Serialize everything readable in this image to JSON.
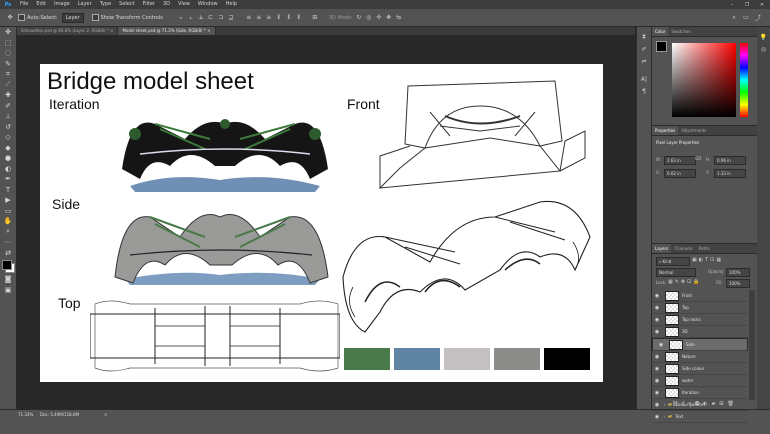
{
  "menubar": {
    "logo": "Ps",
    "items": [
      "File",
      "Edit",
      "Image",
      "Layer",
      "Type",
      "Select",
      "Filter",
      "3D",
      "View",
      "Window",
      "Help"
    ],
    "window_controls": [
      "–",
      "❐",
      "✕"
    ]
  },
  "options": {
    "auto_select_label": "Auto-Select:",
    "auto_select_value": "Layer",
    "show_transform_label": "Show Transform Controls",
    "mode_label": "3D Mode:"
  },
  "tabs": [
    {
      "label": "Silhouettes.psd @ 66.8% (Layer 2, RGB/8) *"
    },
    {
      "label": "Model sheet.psd @ 71.3% (Side, RGB/8) *"
    }
  ],
  "canvas": {
    "title": "Bridge model sheet",
    "labels": {
      "iteration": "Iteration",
      "front": "Front",
      "side": "Side",
      "top": "Top"
    },
    "swatches": [
      "#4a7a4a",
      "#5f84a4",
      "#c4c0c2",
      "#8c8c8a",
      "#000000"
    ]
  },
  "status": {
    "zoom": "71.33%",
    "doc": "Doc: 5.49M/118.6M",
    "arrow": ">"
  },
  "color_panel": {
    "tabs": [
      "Color",
      "Swatches"
    ],
    "hue_color": "#ff0000"
  },
  "properties_panel": {
    "tabs": [
      "Properties",
      "Adjustments"
    ],
    "title": "Pixel Layer Properties",
    "w_label": "W:",
    "w_value": "2.63 in",
    "h_label": "H:",
    "h_value": "0.96 in",
    "x_label": "X:",
    "x_value": "0.02 in",
    "y_label": "Y:",
    "y_value": "1.33 in",
    "link": "GO"
  },
  "layers_panel": {
    "tabs": [
      "Layers",
      "Channels",
      "Paths"
    ],
    "kind": "Kind",
    "blend": "Normal",
    "opacity_label": "Opacity:",
    "opacity_value": "100%",
    "lock_label": "Lock:",
    "fill_label": "Fill:",
    "fill_value": "100%",
    "layers": [
      {
        "name": "Front"
      },
      {
        "name": "Top"
      },
      {
        "name": "Top rocks"
      },
      {
        "name": "3D"
      },
      {
        "name": "Side"
      },
      {
        "name": "Nature"
      },
      {
        "name": "Side colour"
      },
      {
        "name": "water"
      },
      {
        "name": "Iteration"
      },
      {
        "name": "Colour pallete"
      },
      {
        "name": "Text"
      }
    ]
  }
}
